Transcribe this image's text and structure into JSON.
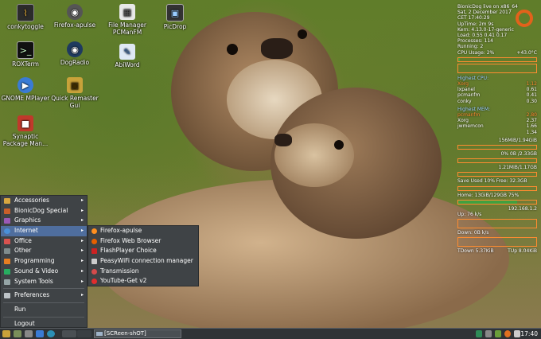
{
  "desktop_icons": [
    {
      "label": "conkytoggle",
      "icon": "chart-icon"
    },
    {
      "label": "ROXTerm",
      "icon": "terminal-icon"
    },
    {
      "label": "GNOME MPlayer",
      "icon": "media-player-icon"
    },
    {
      "label": "Synaptic Package Man...",
      "icon": "package-icon"
    },
    {
      "label": "Firefox-apulse",
      "icon": "firefox-icon"
    },
    {
      "label": "DogRadio",
      "icon": "radio-icon"
    },
    {
      "label": "Quick Remaster Gui",
      "icon": "lock-icon"
    },
    {
      "label": "File Manager PCManFM",
      "icon": "folder-icon"
    },
    {
      "label": "AbiWord",
      "icon": "document-icon"
    },
    {
      "label": "PicDrop",
      "icon": "image-icon"
    }
  ],
  "conky": {
    "header": "BionicDog live on x86_64",
    "date": "Sat,  2 December 2017",
    "time": "CET    17:40:29",
    "uptime": "UpTime: 2m 9s",
    "kern": "Kern: 4.13.0-17-generic",
    "load": "Load: 0.55 0.41 0.17",
    "processes": "Processes: 114",
    "running": "Running: 2",
    "cpu_usage": "CPU Usage: 2%",
    "temp": "+43.0°C",
    "cpu_title": "Highest CPU:",
    "cpu_procs": [
      {
        "name": "Xorg",
        "val": "1.12"
      },
      {
        "name": "lxpanel",
        "val": "0.61"
      },
      {
        "name": "pcmanfm",
        "val": "0.41"
      },
      {
        "name": "conky",
        "val": "0.30"
      }
    ],
    "mem_title": "Highest MEM:",
    "mem_procs": [
      {
        "name": "pcmanfm",
        "val": "2.80"
      },
      {
        "name": "Xorg",
        "val": "2.37"
      },
      {
        "name": "jwmemcon",
        "val": "1.66"
      },
      {
        "name": "",
        "val": "1.34"
      }
    ],
    "ram": "156MiB/1.94GiB",
    "swap": "0% 0B /2.33GB",
    "disk1": "1.21MiB/1.17GB",
    "space": "Save Used 10% Free: 32.3GB",
    "home": "Home: 13GiB/129GB 75%",
    "ip": "192.168.1.2",
    "up": "Up: 76 k/s",
    "down": "Down: 0B k/s",
    "tdown": "TDown 5.37KiB",
    "tup": "TUp 8.04KiB",
    "cpu_fraction": 0.02,
    "home_fraction": 0.75
  },
  "start_menu": {
    "items": [
      {
        "label": "Accessories",
        "icon": "accessories-icon",
        "color": "#d8a640",
        "submenu": true
      },
      {
        "label": "BionicDog Special",
        "icon": "dog-icon",
        "color": "#c95f2a",
        "submenu": true
      },
      {
        "label": "Graphics",
        "icon": "graphics-icon",
        "color": "#9b59b6",
        "submenu": true
      },
      {
        "label": "Internet",
        "icon": "globe-icon",
        "color": "#4a90d9",
        "submenu": true
      },
      {
        "label": "Office",
        "icon": "office-icon",
        "color": "#d9534f",
        "submenu": true
      },
      {
        "label": "Other",
        "icon": "other-icon",
        "color": "#7f8c8d",
        "submenu": true
      },
      {
        "label": "Programming",
        "icon": "code-icon",
        "color": "#e67e22",
        "submenu": true
      },
      {
        "label": "Sound & Video",
        "icon": "speaker-icon",
        "color": "#27ae60",
        "submenu": true
      },
      {
        "label": "System Tools",
        "icon": "tools-icon",
        "color": "#95a5a6",
        "submenu": true
      }
    ],
    "bottom": [
      {
        "label": "Preferences",
        "icon": "preferences-icon",
        "color": "#bdc3c7",
        "submenu": true
      },
      {
        "label": "Run",
        "icon": "run-icon",
        "color": "",
        "submenu": false
      },
      {
        "label": "Logout",
        "icon": "logout-icon",
        "color": "",
        "submenu": false
      }
    ]
  },
  "internet_submenu": [
    {
      "label": "Firefox-apulse",
      "icon": "firefox-icon",
      "color": "#ff8f1f"
    },
    {
      "label": "Firefox Web Browser",
      "icon": "firefox-icon",
      "color": "#e66000"
    },
    {
      "label": "FlashPlayer Choice",
      "icon": "flash-icon",
      "color": "#cc2222"
    },
    {
      "label": "PeasyWiFi connection manager",
      "icon": "wifi-icon",
      "color": "#cccccc"
    },
    {
      "label": "Transmission",
      "icon": "transmission-icon",
      "color": "#d44b4b"
    },
    {
      "label": "YouTube-Get v2",
      "icon": "youtube-icon",
      "color": "#e02d2d"
    }
  ],
  "taskbar": {
    "window_title": "[SCReen-shOT]",
    "clock": "17:40"
  }
}
